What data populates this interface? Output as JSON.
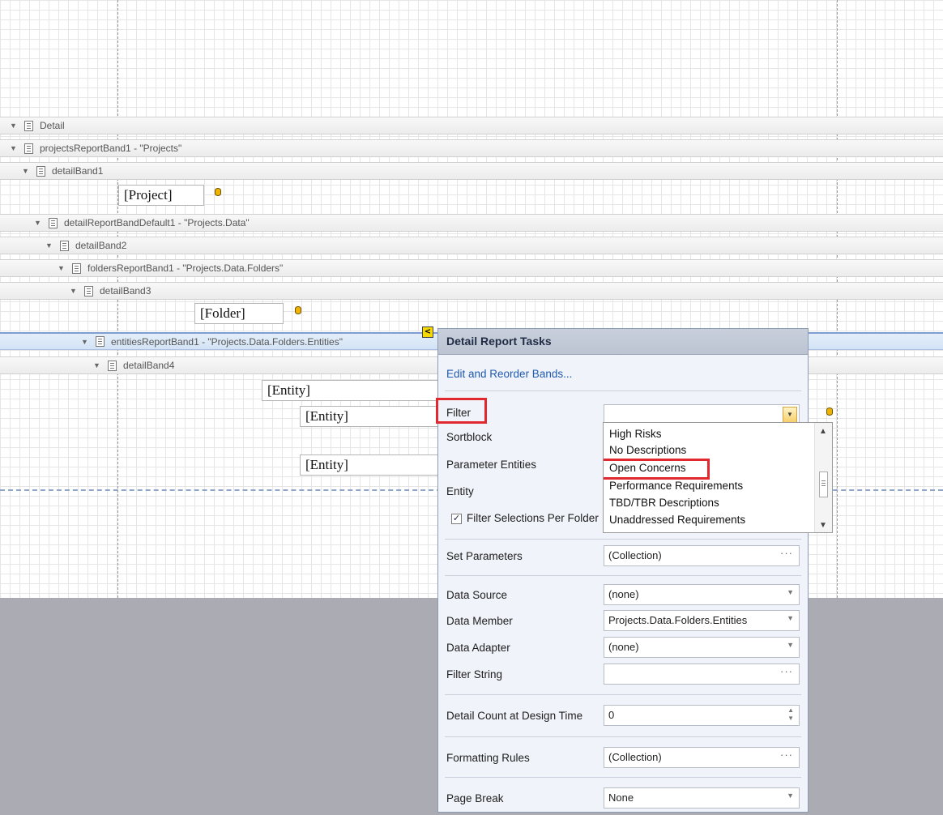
{
  "bands": [
    {
      "label": "Detail"
    },
    {
      "label": "projectsReportBand1 - \"Projects\""
    },
    {
      "label": "detailBand1"
    },
    {
      "label": "detailReportBandDefault1 - \"Projects.Data\""
    },
    {
      "label": "detailBand2"
    },
    {
      "label": "foldersReportBand1 - \"Projects.Data.Folders\""
    },
    {
      "label": "detailBand3"
    },
    {
      "label": "entitiesReportBand1 - \"Projects.Data.Folders.Entities\""
    },
    {
      "label": "detailBand4"
    }
  ],
  "fields": {
    "project": "[Project]",
    "folder": "[Folder]",
    "entity1": "[Entity]",
    "entity2": "[Entity]",
    "entity3": "[Entity]"
  },
  "smart_tag_glyph": "<",
  "tasks": {
    "title": "Detail Report Tasks",
    "edit_link": "Edit and Reorder Bands...",
    "filter_label": "Filter",
    "filter_value": "",
    "sortblock_label": "Sortblock",
    "param_entities_label": "Parameter Entities",
    "entity_label": "Entity",
    "filter_per_folder_label": "Filter Selections Per Folder",
    "filter_per_folder_checked": true,
    "set_parameters_label": "Set Parameters",
    "set_parameters_value": "(Collection)",
    "data_source_label": "Data Source",
    "data_source_value": "(none)",
    "data_member_label": "Data Member",
    "data_member_value": "Projects.Data.Folders.Entities",
    "data_adapter_label": "Data Adapter",
    "data_adapter_value": "(none)",
    "filter_string_label": "Filter String",
    "filter_string_value": "",
    "detail_count_label": "Detail Count at Design Time",
    "detail_count_value": "0",
    "formatting_rules_label": "Formatting Rules",
    "formatting_rules_value": "(Collection)",
    "page_break_label": "Page Break",
    "page_break_value": "None"
  },
  "filter_options": [
    "High Risks",
    "No Descriptions",
    "Open Concerns",
    "Performance Requirements",
    "TBD/TBR Descriptions",
    "Unaddressed Requirements"
  ],
  "highlighted_option": "Open Concerns"
}
